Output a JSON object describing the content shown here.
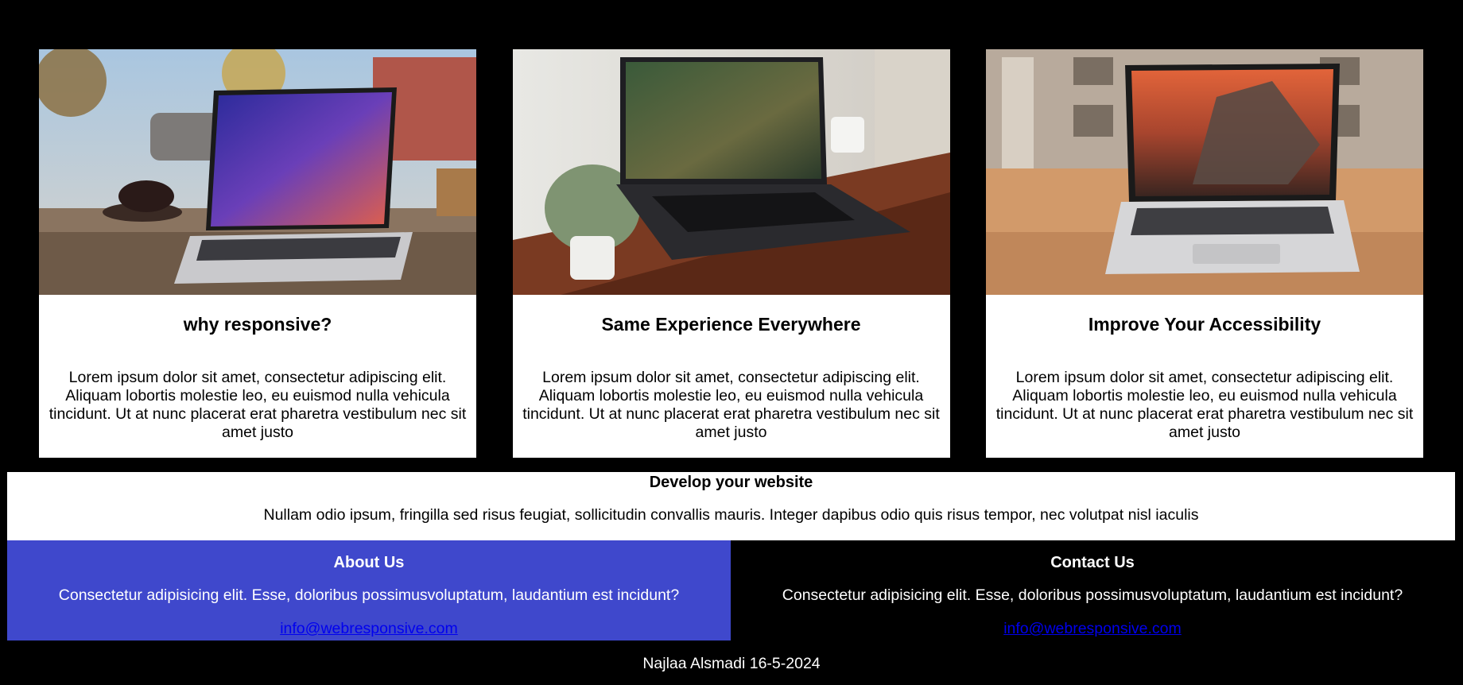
{
  "cards": [
    {
      "image_icon": "laptop-outdoor-photo",
      "title": "why responsive?",
      "text": "Lorem ipsum dolor sit amet, consectetur adipiscing elit. Aliquam lobortis molestie leo, eu euismod nulla vehicula tincidunt. Ut at nunc placerat erat pharetra vestibulum nec sit amet justo"
    },
    {
      "image_icon": "laptop-desk-plant-photo",
      "title": "Same Experience Everywhere",
      "text": "Lorem ipsum dolor sit amet, consectetur adipiscing elit. Aliquam lobortis molestie leo, eu euismod nulla vehicula tincidunt. Ut at nunc placerat erat pharetra vestibulum nec sit amet justo"
    },
    {
      "image_icon": "laptop-mountain-photo",
      "title": "Improve Your Accessibility",
      "text": "Lorem ipsum dolor sit amet, consectetur adipiscing elit. Aliquam lobortis molestie leo, eu euismod nulla vehicula tincidunt. Ut at nunc placerat erat pharetra vestibulum nec sit amet justo"
    }
  ],
  "develop": {
    "title": "Develop your website",
    "text": "Nullam odio ipsum, fringilla sed risus feugiat, sollicitudin convallis mauris. Integer dapibus odio quis risus tempor, nec volutpat nisl iaculis"
  },
  "about": {
    "title": "About Us",
    "text": "Consectetur adipisicing elit. Esse, doloribus possimusvoluptatum, laudantium est incidunt?",
    "email": "info@webresponsive.com"
  },
  "contact": {
    "title": "Contact Us",
    "text": "Consectetur adipisicing elit. Esse, doloribus possimusvoluptatum, laudantium est incidunt?",
    "email": "info@webresponsive.com"
  },
  "credit": "Najlaa Alsmadi 16-5-2024",
  "colors": {
    "page_background": "#000000",
    "card_background": "#ffffff",
    "about_background": "#3f48cc",
    "link": "#0000ee"
  }
}
